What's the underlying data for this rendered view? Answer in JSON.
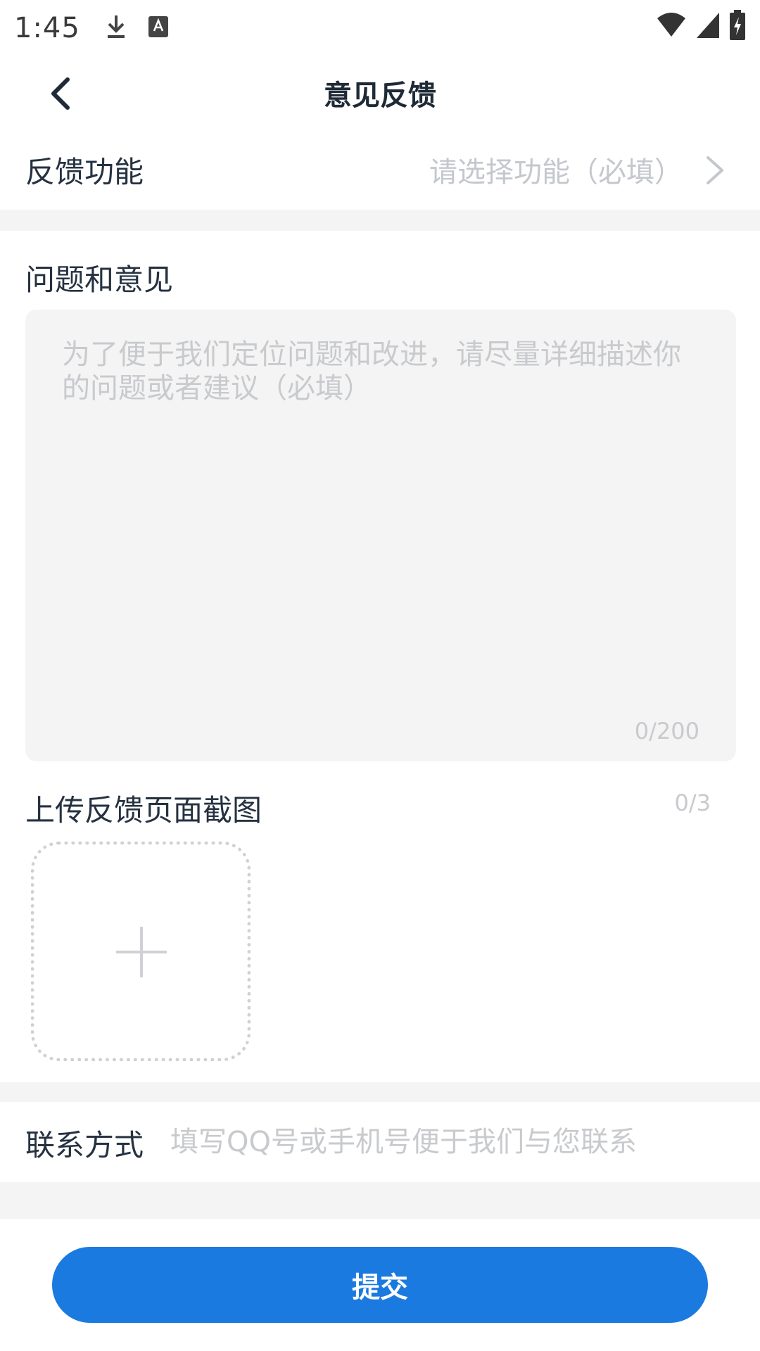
{
  "status_bar": {
    "time": "1:45",
    "icons": [
      "download-icon",
      "keyboard-a-icon",
      "wifi-icon",
      "signal-icon",
      "battery-icon"
    ]
  },
  "app_bar": {
    "title": "意见反馈",
    "back_icon": "chevron-left-icon"
  },
  "function_row": {
    "label": "反馈功能",
    "placeholder": "请选择功能（必填）",
    "icon": "chevron-right-icon"
  },
  "feedback": {
    "label": "问题和意见",
    "placeholder": "为了便于我们定位问题和改进，请尽量详细描述你的问题或者建议（必填）",
    "count": "0/200"
  },
  "upload": {
    "label": "上传反馈页面截图",
    "count": "0/3",
    "icon": "plus-icon"
  },
  "contact": {
    "label": "联系方式",
    "placeholder": "填写QQ号或手机号便于我们与您联系",
    "value": ""
  },
  "submit": {
    "label": "提交"
  },
  "colors": {
    "accent": "#1b7ae0",
    "background_band": "#f4f4f4",
    "placeholder": "#c8cacd",
    "text": "#263241"
  }
}
